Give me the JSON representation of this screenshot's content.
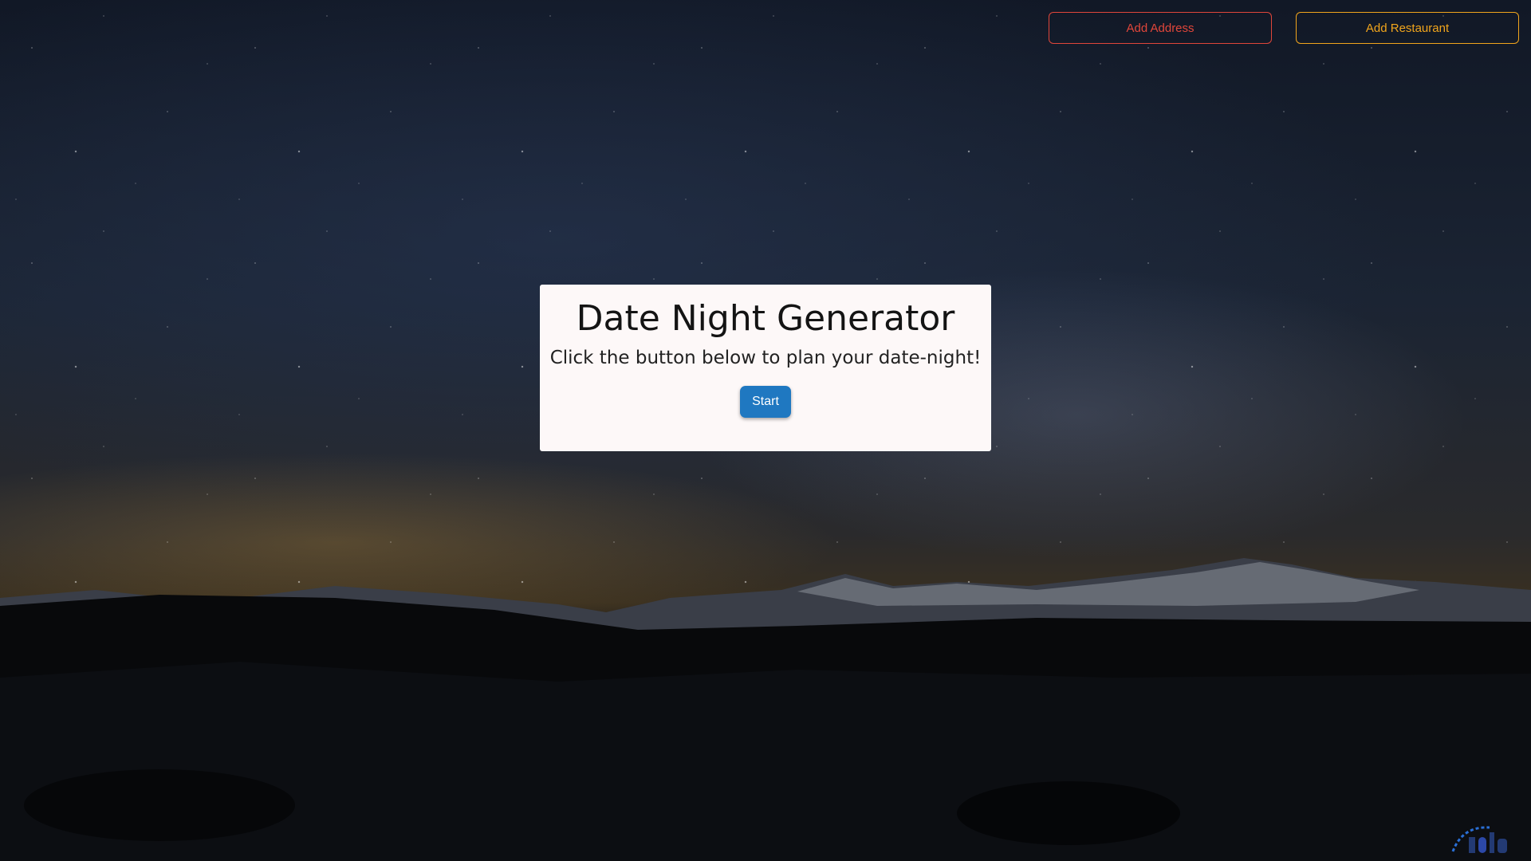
{
  "header": {
    "add_address_label": "Add Address",
    "add_restaurant_label": "Add Restaurant"
  },
  "main": {
    "title": "Date Night Generator",
    "subtitle": "Click the button below to plan your date-night!",
    "start_label": "Start"
  },
  "colors": {
    "add_address": "#e0463a",
    "add_restaurant": "#f1a51c",
    "start_button": "#1f78c1",
    "card_background": "#fdf8f8"
  },
  "icons": {
    "watermark": "brand-logo-icon"
  }
}
